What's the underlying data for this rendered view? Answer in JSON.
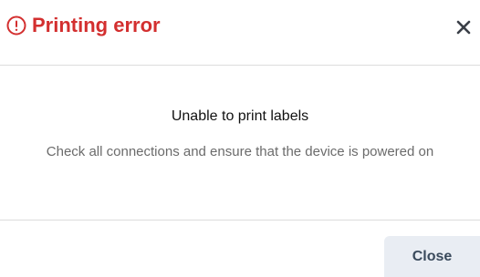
{
  "dialog": {
    "title": "Printing error",
    "heading": "Unable to print labels",
    "message": "Check all connections and ensure that the device is powered on",
    "close_button_label": "Close",
    "icons": {
      "title_icon": "error-circle-icon",
      "dismiss_icon": "close-icon"
    },
    "colors": {
      "error": "#d32f2f",
      "button_bg": "#e9edf3",
      "button_text": "#3a4a5c",
      "message_text": "#6b6b6b"
    }
  }
}
